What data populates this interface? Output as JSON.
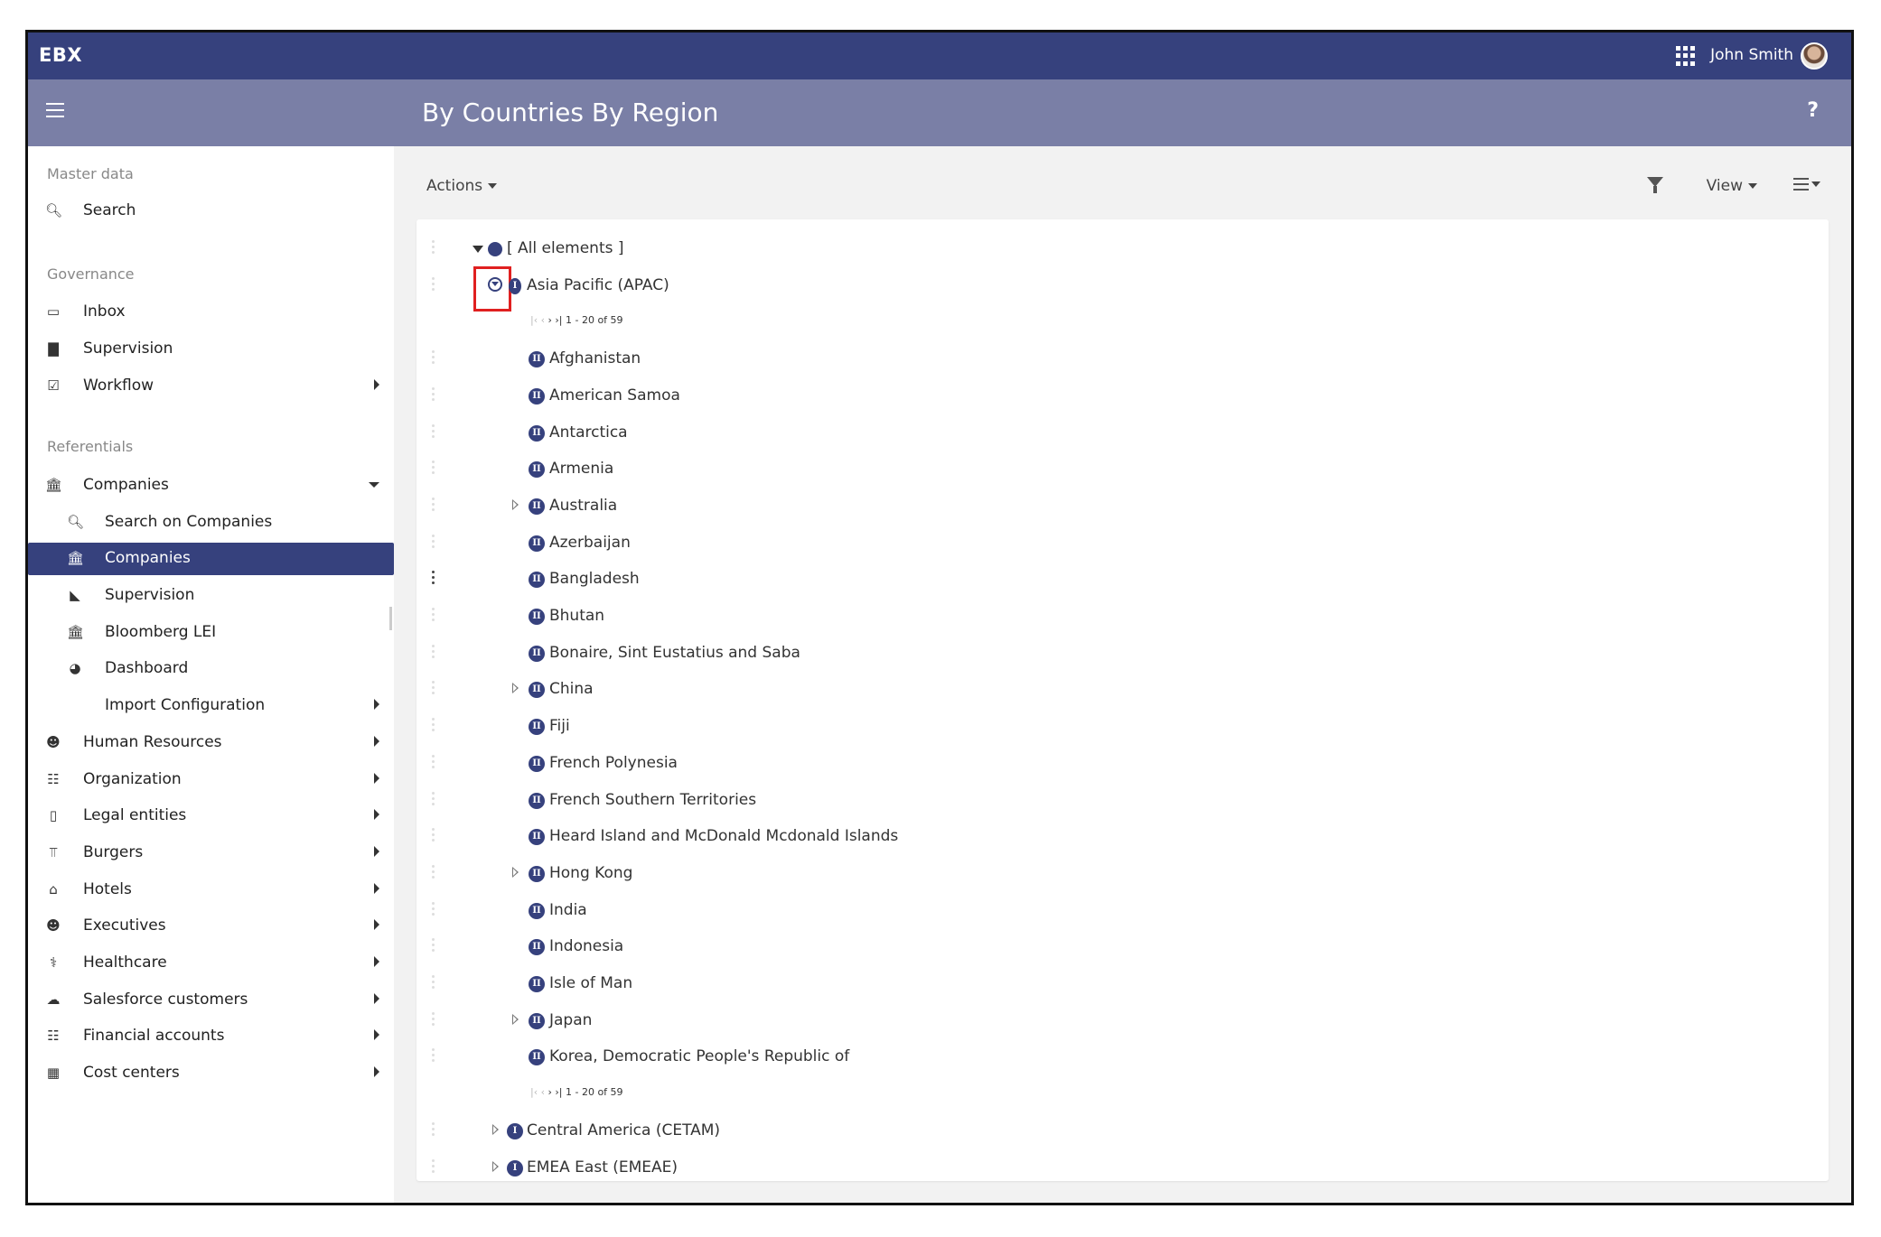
{
  "app": {
    "logo": "EBX",
    "user_name": "John Smith",
    "help": "?"
  },
  "header": {
    "title": "By Countries By Region"
  },
  "sidebar": {
    "section_master": "Master data",
    "search": "Search",
    "section_governance": "Governance",
    "inbox": "Inbox",
    "supervision": "Supervision",
    "workflow": "Workflow",
    "section_referentials": "Referentials",
    "companies": "Companies",
    "search_companies": "Search on Companies",
    "companies_sub": "Companies",
    "supervision_sub": "Supervision",
    "bloomberg": "Bloomberg LEI",
    "dashboard": "Dashboard",
    "import_config": "Import Configuration",
    "human_resources": "Human Resources",
    "organization": "Organization",
    "legal_entities": "Legal entities",
    "burgers": "Burgers",
    "hotels": "Hotels",
    "executives": "Executives",
    "healthcare": "Healthcare",
    "salesforce": "Salesforce customers",
    "financial": "Financial accounts",
    "cost_centers": "Cost centers"
  },
  "toolbar": {
    "actions": "Actions",
    "view": "View"
  },
  "tree": {
    "root": "[ All elements ]",
    "region_apac": "Asia Pacific (APAC)",
    "pager_range": "1 - 20 of 59",
    "countries": [
      "Afghanistan",
      "American Samoa",
      "Antarctica",
      "Armenia",
      "Australia",
      "Azerbaijan",
      "Bangladesh",
      "Bhutan",
      "Bonaire, Sint Eustatius and Saba",
      "China",
      "Fiji",
      "French Polynesia",
      "French Southern Territories",
      "Heard Island and McDonald Mcdonald Islands",
      "Hong Kong",
      "India",
      "Indonesia",
      "Isle of Man",
      "Japan",
      "Korea, Democratic People's Republic of"
    ],
    "region_cetam": "Central America (CETAM)",
    "region_emeae": "EMEA East (EMEAE)"
  }
}
